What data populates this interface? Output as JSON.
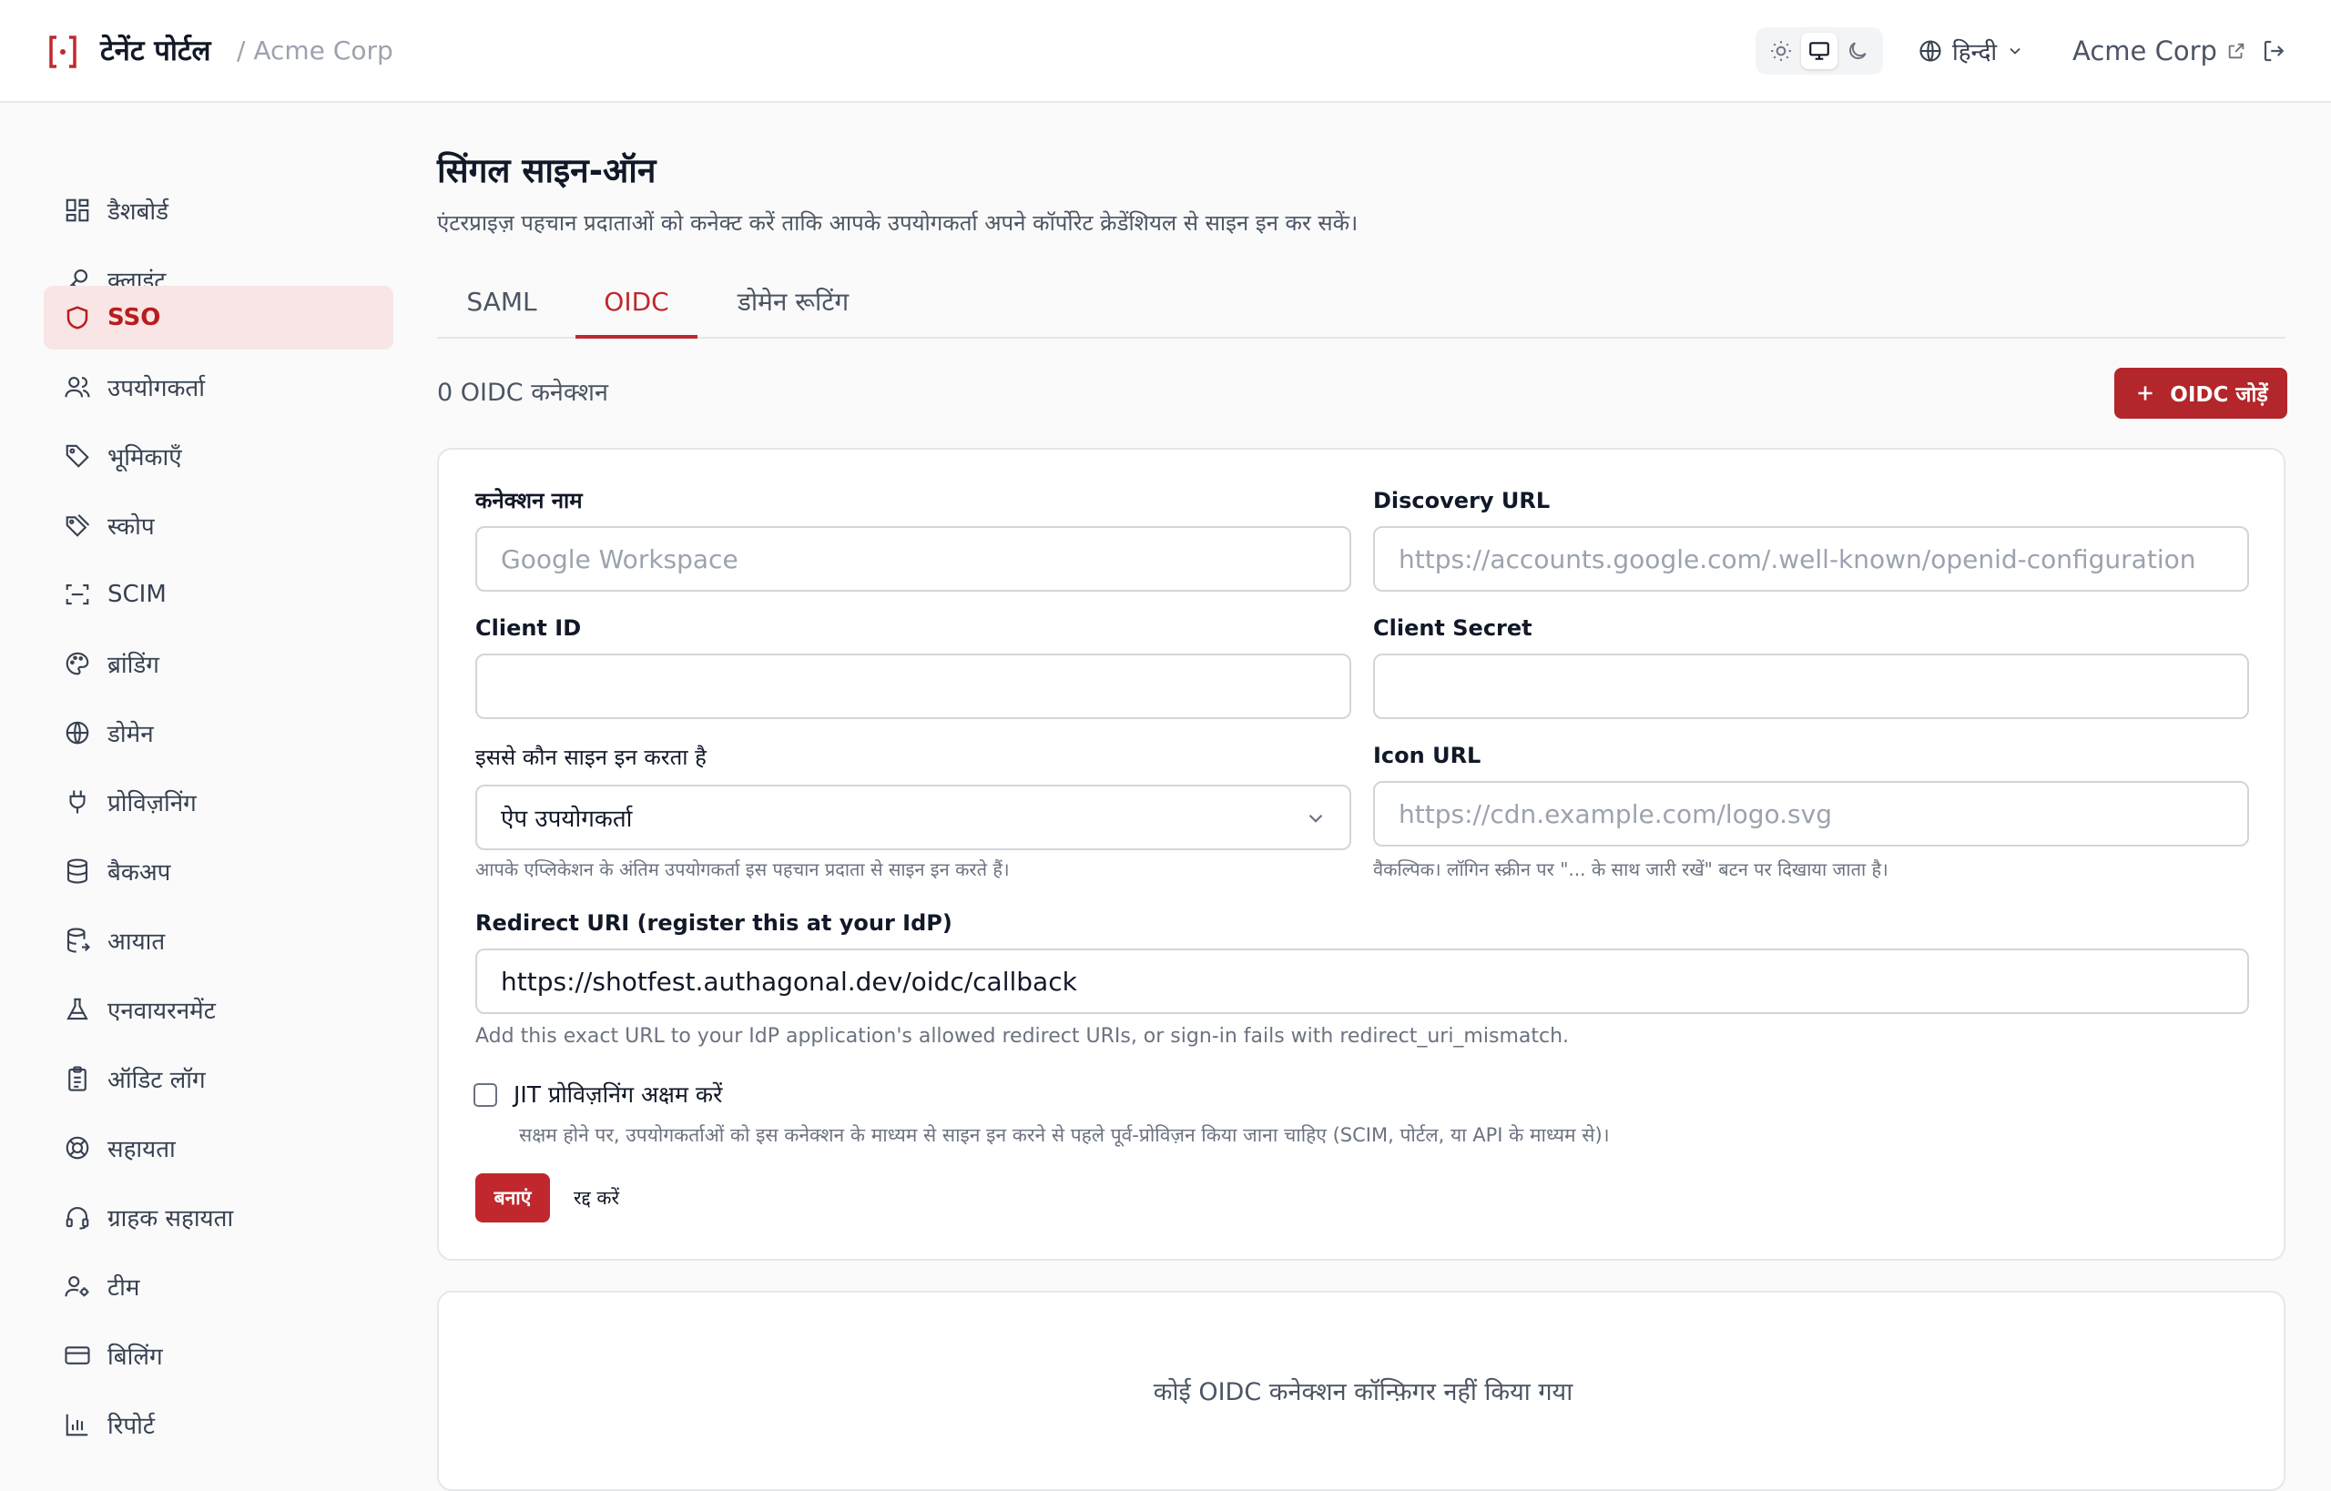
{
  "header": {
    "brand_icon": "[·]",
    "title": "टेनेंट पोर्टल",
    "breadcrumb": "/ Acme Corp",
    "theme_options": [
      "light-icon",
      "monitor-icon",
      "moon-icon"
    ],
    "active_theme": "monitor-icon",
    "language": "हिन्दी",
    "org_link": "Acme Corp"
  },
  "sidebar": {
    "items": [
      {
        "label": "डैशबोर्ड",
        "icon": "dashboard-icon"
      },
      {
        "label": "क्लाइंट",
        "icon": "key-icon"
      },
      {
        "label": "SSO",
        "icon": "shield-icon",
        "active": true
      },
      {
        "label": "उपयोगकर्ता",
        "icon": "users-icon"
      },
      {
        "label": "भूमिकाएँ",
        "icon": "tag-icon"
      },
      {
        "label": "स्कोप",
        "icon": "tags-icon"
      },
      {
        "label": "SCIM",
        "icon": "scan-icon"
      },
      {
        "label": "ब्रांडिंग",
        "icon": "palette-icon"
      },
      {
        "label": "डोमेन",
        "icon": "globe-icon"
      },
      {
        "label": "प्रोविज़निंग",
        "icon": "plug-icon"
      },
      {
        "label": "बैकअप",
        "icon": "database-icon"
      },
      {
        "label": "आयात",
        "icon": "database-import-icon"
      },
      {
        "label": "एनवायरनमेंट",
        "icon": "flask-icon"
      },
      {
        "label": "ऑडिट लॉग",
        "icon": "clipboard-icon"
      },
      {
        "label": "सहायता",
        "icon": "lifebuoy-icon"
      },
      {
        "label": "ग्राहक सहायता",
        "icon": "headset-icon"
      },
      {
        "label": "टीम",
        "icon": "user-cog-icon"
      },
      {
        "label": "बिलिंग",
        "icon": "credit-card-icon"
      },
      {
        "label": "रिपोर्ट",
        "icon": "bar-chart-icon"
      }
    ]
  },
  "main": {
    "title": "सिंगल साइन-ऑन",
    "description": "एंटरप्राइज़ पहचान प्रदाताओं को कनेक्ट करें ताकि आपके उपयोगकर्ता अपने कॉर्पोरेट क्रेडेंशियल से साइन इन कर सकें।",
    "tabs": [
      {
        "label": "SAML"
      },
      {
        "label": "OIDC",
        "active": true
      },
      {
        "label": "डोमेन रूटिंग"
      }
    ],
    "connection_count": "0 OIDC कनेक्शन",
    "add_button": "OIDC जोड़ें",
    "form": {
      "name_label": "कनेक्शन नाम",
      "name_placeholder": "Google Workspace",
      "discovery_label": "Discovery URL",
      "discovery_placeholder": "https://accounts.google.com/.well-known/openid-configuration",
      "client_id_label": "Client ID",
      "client_id_value": "",
      "client_secret_label": "Client Secret",
      "client_secret_value": "",
      "who_label": "इससे कौन साइन इन करता है",
      "who_value": "ऐप उपयोगकर्ता",
      "who_help": "आपके एप्लिकेशन के अंतिम उपयोगकर्ता इस पहचान प्रदाता से साइन इन करते हैं।",
      "icon_label": "Icon URL",
      "icon_placeholder": "https://cdn.example.com/logo.svg",
      "icon_help": "वैकल्पिक। लॉगिन स्क्रीन पर \"... के साथ जारी रखें\" बटन पर दिखाया जाता है।",
      "redirect_label": "Redirect URI (register this at your IdP)",
      "redirect_value": "https://shotfest.authagonal.dev/oidc/callback",
      "redirect_help": "Add this exact URL to your IdP application's allowed redirect URIs, or sign-in fails with redirect_uri_mismatch.",
      "jit_label": "JIT प्रोविज़निंग अक्षम करें",
      "jit_checked": false,
      "jit_help": "सक्षम होने पर, उपयोगकर्ताओं को इस कनेक्शन के माध्यम से साइन इन करने से पहले पूर्व-प्रोविज़न किया जाना चाहिए (SCIM, पोर्टल, या API के माध्यम से)।",
      "create_button": "बनाएं",
      "cancel_button": "रद्द करें"
    },
    "empty_state": "कोई OIDC कनेक्शन कॉन्फ़िगर नहीं किया गया"
  },
  "colors": {
    "accent": "#c0282d",
    "active_nav_bg": "#f9e5e6"
  }
}
